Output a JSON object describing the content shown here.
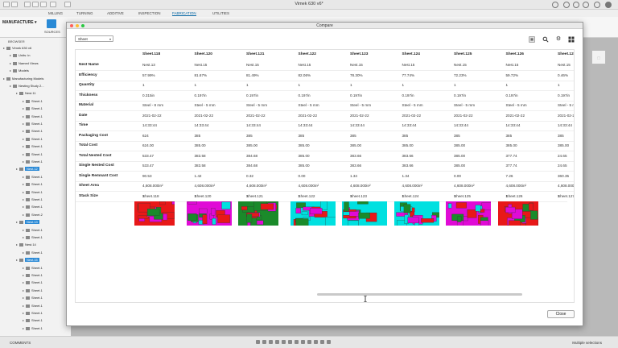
{
  "app": {
    "doc_title": "Vimek 630 v6*",
    "tabs": [
      "MILLING",
      "TURNING",
      "ADDITIVE",
      "INSPECTION",
      "FABRICATION",
      "UTILITIES"
    ],
    "active_tab": "FABRICATION",
    "workspace": "MANUFACTURE",
    "sources_label": "SOURCES"
  },
  "browser": {
    "header": "BROWSER",
    "items": [
      {
        "label": "Vimek 630 v6",
        "depth": 0,
        "sel": false
      },
      {
        "label": "Units: in",
        "depth": 1,
        "sel": false
      },
      {
        "label": "Named Views",
        "depth": 1,
        "sel": false
      },
      {
        "label": "Models",
        "depth": 1,
        "sel": false
      },
      {
        "label": "Manufacturing Models",
        "depth": 0,
        "sel": false
      },
      {
        "label": "Nesting Study 2...",
        "depth": 1,
        "sel": false
      },
      {
        "label": "Nest.11",
        "depth": 2,
        "sel": false
      },
      {
        "label": "Sheet.1",
        "depth": 3,
        "sel": false
      },
      {
        "label": "Sheet.1",
        "depth": 3,
        "sel": false
      },
      {
        "label": "Sheet.1",
        "depth": 3,
        "sel": false
      },
      {
        "label": "Sheet.1",
        "depth": 3,
        "sel": false
      },
      {
        "label": "Sheet.1",
        "depth": 3,
        "sel": false
      },
      {
        "label": "Sheet.1",
        "depth": 3,
        "sel": false
      },
      {
        "label": "Sheet.1",
        "depth": 3,
        "sel": false
      },
      {
        "label": "Sheet.1",
        "depth": 3,
        "sel": false
      },
      {
        "label": "Sheet.1",
        "depth": 3,
        "sel": false
      },
      {
        "label": "Nest.12",
        "depth": 2,
        "sel": true
      },
      {
        "label": "Sheet.1",
        "depth": 3,
        "sel": false
      },
      {
        "label": "Sheet.1",
        "depth": 3,
        "sel": false
      },
      {
        "label": "Sheet.1",
        "depth": 3,
        "sel": false
      },
      {
        "label": "Sheet.1",
        "depth": 3,
        "sel": false
      },
      {
        "label": "Sheet.1",
        "depth": 3,
        "sel": false
      },
      {
        "label": "Sheet.2",
        "depth": 3,
        "sel": false
      },
      {
        "label": "Nest.13",
        "depth": 2,
        "sel": true
      },
      {
        "label": "Sheet.1",
        "depth": 3,
        "sel": false
      },
      {
        "label": "Sheet.1",
        "depth": 3,
        "sel": false
      },
      {
        "label": "Nest.14",
        "depth": 2,
        "sel": false
      },
      {
        "label": "Sheet.1",
        "depth": 3,
        "sel": false
      },
      {
        "label": "Nest.15",
        "depth": 2,
        "sel": true
      },
      {
        "label": "Sheet.1",
        "depth": 3,
        "sel": false
      },
      {
        "label": "Sheet.1",
        "depth": 3,
        "sel": false
      },
      {
        "label": "Sheet.1",
        "depth": 3,
        "sel": false
      },
      {
        "label": "Sheet.1",
        "depth": 3,
        "sel": false
      },
      {
        "label": "Sheet.1",
        "depth": 3,
        "sel": false
      },
      {
        "label": "Sheet.1",
        "depth": 3,
        "sel": false
      },
      {
        "label": "Sheet.1",
        "depth": 3,
        "sel": false
      },
      {
        "label": "Sheet.1",
        "depth": 3,
        "sel": false
      },
      {
        "label": "Sheet.1",
        "depth": 3,
        "sel": false
      }
    ]
  },
  "dialog": {
    "title": "Compare",
    "select_value": "Sheet",
    "close_label": "Close",
    "row_labels": [
      "Nest Name",
      "Efficiency",
      "Quantity",
      "Thickness",
      "Material",
      "Date",
      "Time",
      "Packaging Cost",
      "Total Cost",
      "Total Nested Cost",
      "Single Nested Cost",
      "Single Remnant Cost",
      "Sheet Area",
      "Stack Size"
    ],
    "columns": [
      {
        "name": "Sheet.118",
        "values": [
          "Nest.13",
          "57.99%",
          "1",
          "0.315in",
          "Steel - 8 mm",
          "2021-02-22",
          "14:33:44",
          "624",
          "624.00",
          "533.47",
          "533.47",
          "90.53",
          "4,608.000in²",
          "1"
        ]
      },
      {
        "name": "Sheet.120",
        "values": [
          "Nest.15",
          "81.67%",
          "1",
          "0.197in",
          "Steel - 5 mm",
          "2021-02-22",
          "14:33:44",
          "385",
          "385.00",
          "383.58",
          "383.58",
          "1.42",
          "4,608.000in²",
          "1"
        ]
      },
      {
        "name": "Sheet.121",
        "values": [
          "Nest.15",
          "81.49%",
          "1",
          "0.197in",
          "Steel - 5 mm",
          "2021-02-22",
          "14:33:44",
          "385",
          "385.00",
          "384.68",
          "384.68",
          "0.32",
          "4,608.000in²",
          "1"
        ]
      },
      {
        "name": "Sheet.122",
        "values": [
          "Nest.15",
          "82.06%",
          "1",
          "0.197in",
          "Steel - 5 mm",
          "2021-02-22",
          "14:33:44",
          "385",
          "385.00",
          "385.00",
          "385.00",
          "0.00",
          "4,608.000in²",
          "1"
        ]
      },
      {
        "name": "Sheet.123",
        "values": [
          "Nest.15",
          "78.30%",
          "1",
          "0.197in",
          "Steel - 5 mm",
          "2021-02-22",
          "14:33:44",
          "385",
          "385.00",
          "383.66",
          "383.66",
          "1.34",
          "4,608.000in²",
          "1"
        ]
      },
      {
        "name": "Sheet.124",
        "values": [
          "Nest.15",
          "77.74%",
          "1",
          "0.197in",
          "Steel - 5 mm",
          "2021-02-22",
          "14:33:44",
          "385",
          "385.00",
          "383.66",
          "383.66",
          "1.34",
          "4,608.000in²",
          "1"
        ]
      },
      {
        "name": "Sheet.125",
        "values": [
          "Nest.15",
          "72.23%",
          "1",
          "0.197in",
          "Steel - 5 mm",
          "2021-02-22",
          "14:33:44",
          "385",
          "385.00",
          "385.00",
          "385.00",
          "0.00",
          "4,608.000in²",
          "1"
        ]
      },
      {
        "name": "Sheet.126",
        "values": [
          "Nest.15",
          "59.72%",
          "1",
          "0.197in",
          "Steel - 5 mm",
          "2021-02-22",
          "14:33:44",
          "385",
          "385.00",
          "377.74",
          "377.74",
          "7.26",
          "4,608.000in²",
          "1"
        ]
      },
      {
        "name": "Sheet.127",
        "values": [
          "Nest.15",
          "0.46%",
          "1",
          "0.197in",
          "Steel - 5 mm",
          "2021-02-22",
          "14:33:44",
          "385",
          "385.00",
          "24.65",
          "24.65",
          "360.35",
          "4,608.000in²",
          "1"
        ]
      }
    ]
  },
  "statusbar": {
    "comments": "COMMENTS",
    "status": "Multiple selections"
  },
  "icons": {
    "view_toggle": "table-view-icon",
    "search": "search-icon",
    "settings": "gear-icon",
    "grid": "grid-icon"
  },
  "colors": {
    "accent": "#2b8ad6",
    "nest_magenta": "#e00ad6",
    "nest_cyan": "#00e0e0",
    "nest_red": "#e81818",
    "nest_green": "#1a8a2a"
  }
}
